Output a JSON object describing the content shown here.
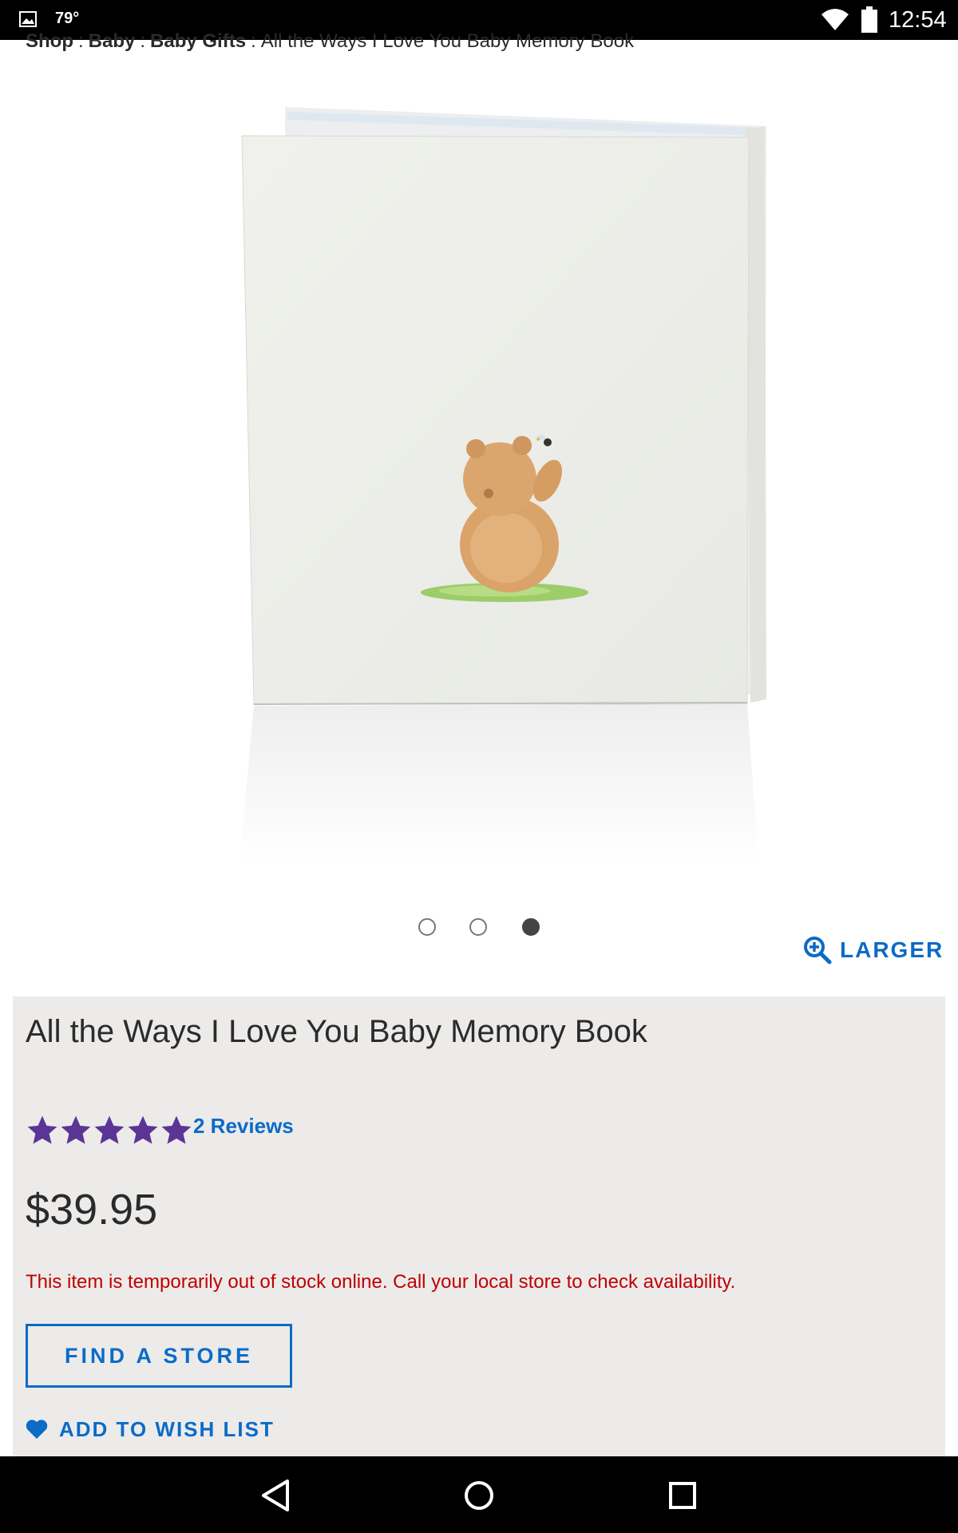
{
  "status_bar": {
    "temperature": "79°",
    "time": "12:54"
  },
  "breadcrumb": {
    "items": [
      "Shop",
      "Baby",
      "Baby Gifts"
    ],
    "separator": ":",
    "current": "All the Ways I Love You Baby Memory Book"
  },
  "carousel": {
    "slide_count": 3,
    "active_index": 2
  },
  "larger_link": "LARGER",
  "product": {
    "title": "All the Ways I Love You Baby Memory Book",
    "rating": 5,
    "rating_max": 5,
    "reviews_label": "2 Reviews",
    "price": "$39.95",
    "stock_message": "This item is temporarily out of stock online. Call your local store to check availability.",
    "find_store_label": "FIND A STORE",
    "wish_list_label": "ADD TO WISH LIST"
  },
  "icons": {
    "gallery": "image-icon",
    "wifi": "wifi-icon",
    "battery": "battery-icon",
    "zoom": "zoom-in-icon",
    "star": "star-icon",
    "heart": "heart-icon",
    "back": "back-icon",
    "home": "home-icon",
    "recents": "recents-icon"
  },
  "colors": {
    "link_blue": "#0b6bc7",
    "star_purple": "#5b3595",
    "alert_red": "#c00000",
    "panel_bg": "#ecebea"
  }
}
